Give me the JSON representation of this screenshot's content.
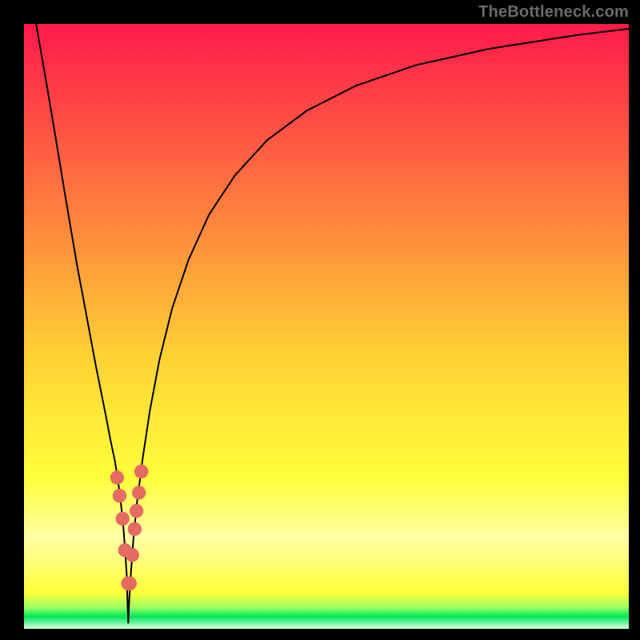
{
  "watermark": "TheBottleneck.com",
  "chart_data": {
    "type": "line",
    "title": "",
    "xlabel": "",
    "ylabel": "",
    "xlim": [
      0,
      100
    ],
    "ylim": [
      0,
      100
    ],
    "grid": false,
    "legend": false,
    "background_gradient": {
      "top": "#ff1a4b",
      "mid_upper": "#ff7c3e",
      "mid": "#ffd234",
      "mid_lower": "#ffff3a",
      "band_pale": "#ffffa6",
      "green": "#00e756",
      "bottom_fade": "#d8ffe5"
    },
    "series": [
      {
        "name": "bottleneck-curve",
        "color": "#000000",
        "x": [
          2.0,
          3.8,
          5.3,
          6.6,
          7.8,
          8.9,
          10.0,
          11.0,
          11.9,
          12.8,
          13.6,
          14.3,
          15.0,
          15.5,
          16.0,
          16.4,
          16.7,
          17.0,
          17.1,
          17.24,
          17.4,
          17.7,
          18.1,
          18.7,
          19.6,
          20.8,
          22.4,
          24.5,
          27.2,
          30.6,
          34.9,
          40.2,
          46.8,
          54.9,
          64.8,
          76.9,
          91.6,
          100.0
        ],
        "y": [
          100.0,
          89.7,
          80.8,
          72.9,
          65.8,
          59.4,
          53.6,
          48.2,
          43.4,
          38.9,
          34.9,
          31.2,
          27.9,
          24.8,
          21.0,
          17.2,
          13.2,
          8.7,
          4.8,
          1.0,
          4.8,
          9.5,
          15.0,
          21.0,
          28.0,
          36.0,
          44.5,
          53.0,
          61.0,
          68.5,
          75.0,
          80.8,
          85.7,
          89.8,
          93.2,
          95.9,
          98.2,
          99.2
        ]
      }
    ],
    "markers": {
      "name": "highlight-dots",
      "color": "#e46a62",
      "radius_frac": 0.0115,
      "points": [
        {
          "x": 15.4,
          "y": 25.0
        },
        {
          "x": 15.8,
          "y": 22.0
        },
        {
          "x": 16.3,
          "y": 18.2
        },
        {
          "x": 16.7,
          "y": 13.0
        },
        {
          "x": 17.2,
          "y": 7.5
        },
        {
          "x": 19.0,
          "y": 22.5
        },
        {
          "x": 19.4,
          "y": 26.0
        },
        {
          "x": 18.3,
          "y": 16.5
        },
        {
          "x": 18.6,
          "y": 19.5
        },
        {
          "x": 17.9,
          "y": 12.2
        },
        {
          "x": 17.5,
          "y": 7.5
        }
      ]
    }
  }
}
